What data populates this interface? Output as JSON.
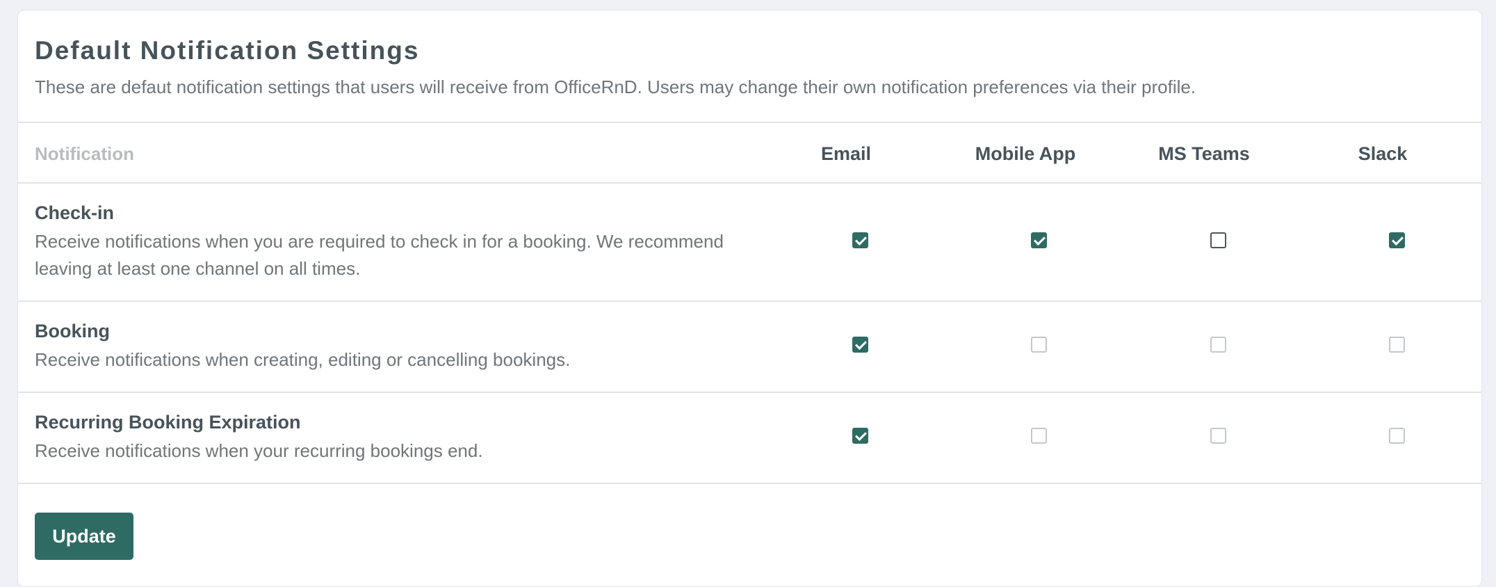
{
  "header": {
    "title": "Default Notification Settings",
    "subtitle": "These are defaut notification settings that users will receive from OfficeRnD. Users may change their own notification preferences via their profile."
  },
  "table": {
    "columns": {
      "notification": "Notification",
      "email": "Email",
      "mobile_app": "Mobile App",
      "ms_teams": "MS Teams",
      "slack": "Slack"
    },
    "rows": [
      {
        "title": "Check-in",
        "description": "Receive notifications when you are required to check in for a booking. We recommend leaving at least one channel on all times.",
        "email": true,
        "mobile_app": true,
        "ms_teams": false,
        "slack": true
      },
      {
        "title": "Booking",
        "description": "Receive notifications when creating, editing or cancelling bookings.",
        "email": true,
        "mobile_app": false,
        "ms_teams": false,
        "slack": false
      },
      {
        "title": "Recurring Booking Expiration",
        "description": "Receive notifications when your recurring bookings end.",
        "email": true,
        "mobile_app": false,
        "ms_teams": false,
        "slack": false
      }
    ]
  },
  "actions": {
    "update_label": "Update"
  },
  "colors": {
    "accent": "#2e6b63",
    "page_background": "#eff1f6",
    "text_primary": "#47535a",
    "text_secondary": "#6f7579"
  }
}
